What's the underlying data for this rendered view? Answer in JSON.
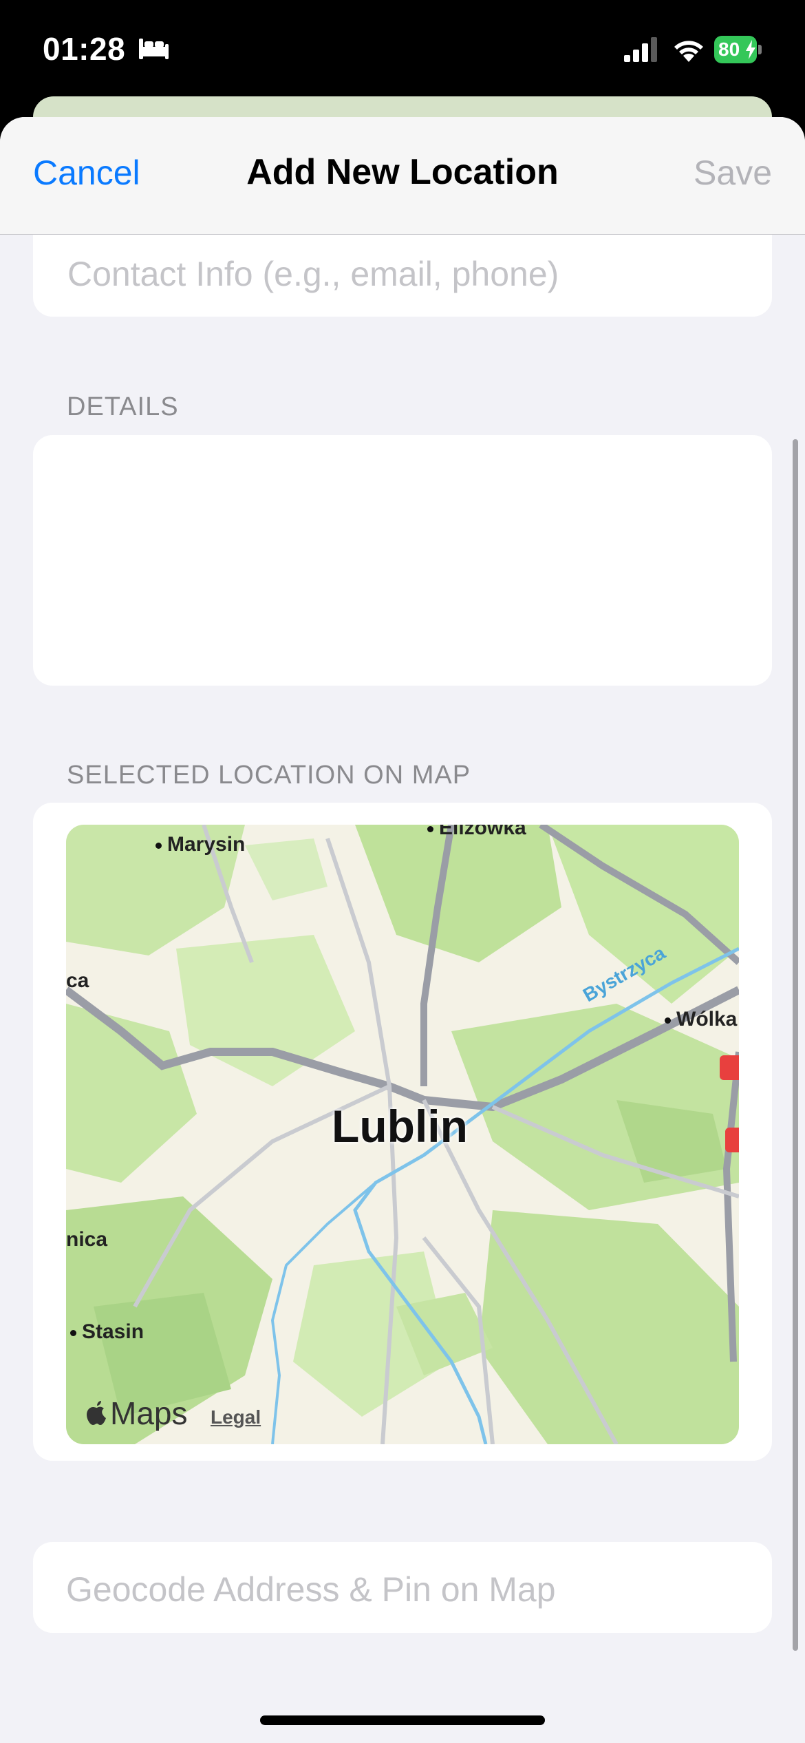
{
  "status_bar": {
    "time": "01:28",
    "battery": "80",
    "icons": [
      "sleep-icon",
      "signal-icon",
      "wifi-icon",
      "battery-icon"
    ]
  },
  "nav": {
    "cancel_label": "Cancel",
    "title": "Add New Location",
    "save_label": "Save"
  },
  "form": {
    "contact_placeholder": "Contact Info (e.g., email, phone)",
    "contact_value": "",
    "details_header": "DETAILS",
    "details_value": "",
    "map_header": "SELECTED LOCATION ON MAP",
    "geocode_label": "Geocode Address & Pin on Map"
  },
  "map": {
    "city": "Lublin",
    "places": {
      "marysin": "Marysin",
      "elizowka": "Elizówka",
      "wolka": "Wólka",
      "stasin": "Stasin",
      "ca": "ca",
      "nica": "nica"
    },
    "river": "Bystrzyca",
    "brand": "Maps",
    "legal": "Legal"
  },
  "colors": {
    "accent": "#0a7aff",
    "disabled": "#b3b3b8",
    "placeholder": "#c4c4c8",
    "background": "#f2f2f7",
    "battery": "#34c759"
  }
}
